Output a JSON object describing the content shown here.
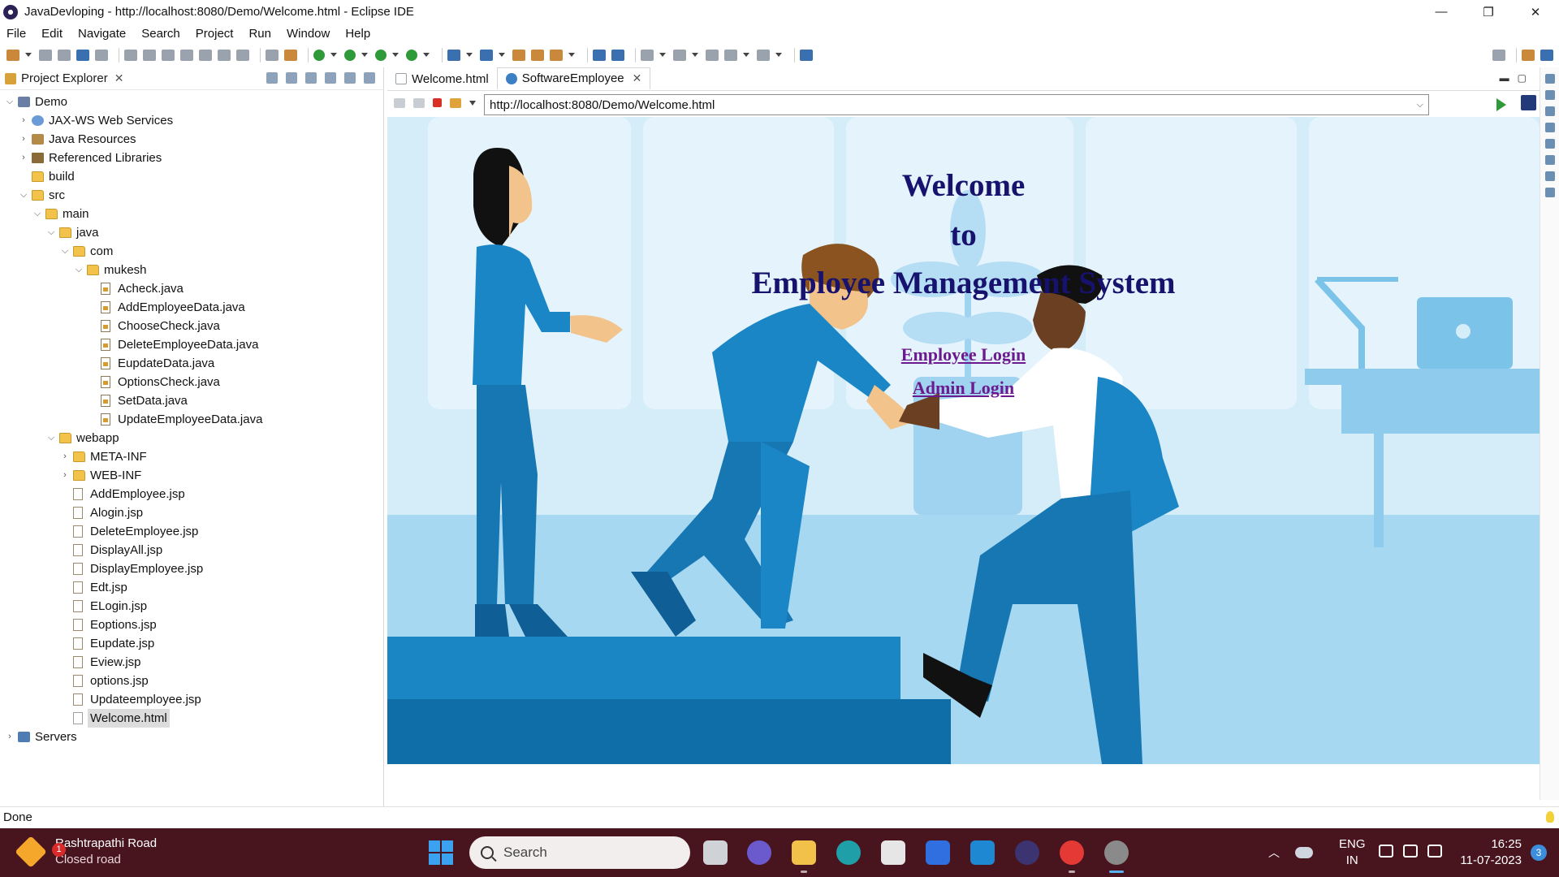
{
  "window": {
    "title": "JavaDevloping - http://localhost:8080/Demo/Welcome.html - Eclipse IDE",
    "controls": [
      "—",
      "❐",
      "✕"
    ]
  },
  "menu": [
    "File",
    "Edit",
    "Navigate",
    "Search",
    "Project",
    "Run",
    "Window",
    "Help"
  ],
  "explorer": {
    "title": "Project Explorer",
    "tree": [
      {
        "label": "Demo",
        "depth": 0,
        "twisty": "open",
        "icon": "project-icon"
      },
      {
        "label": "JAX-WS Web Services",
        "depth": 1,
        "twisty": "closed",
        "icon": "webservice-icon"
      },
      {
        "label": "Java Resources",
        "depth": 1,
        "twisty": "closed",
        "icon": "java-resources-icon"
      },
      {
        "label": "Referenced Libraries",
        "depth": 1,
        "twisty": "closed",
        "icon": "library-icon"
      },
      {
        "label": "build",
        "depth": 1,
        "twisty": "none",
        "icon": "folder-icon"
      },
      {
        "label": "src",
        "depth": 1,
        "twisty": "open",
        "icon": "folder-icon"
      },
      {
        "label": "main",
        "depth": 2,
        "twisty": "open",
        "icon": "folder-icon"
      },
      {
        "label": "java",
        "depth": 3,
        "twisty": "open",
        "icon": "folder-icon"
      },
      {
        "label": "com",
        "depth": 4,
        "twisty": "open",
        "icon": "folder-icon"
      },
      {
        "label": "mukesh",
        "depth": 5,
        "twisty": "open",
        "icon": "folder-icon"
      },
      {
        "label": "Acheck.java",
        "depth": 6,
        "twisty": "none",
        "icon": "java-file-icon"
      },
      {
        "label": "AddEmployeeData.java",
        "depth": 6,
        "twisty": "none",
        "icon": "java-file-icon"
      },
      {
        "label": "ChooseCheck.java",
        "depth": 6,
        "twisty": "none",
        "icon": "java-file-icon"
      },
      {
        "label": "DeleteEmployeeData.java",
        "depth": 6,
        "twisty": "none",
        "icon": "java-file-icon"
      },
      {
        "label": "EupdateData.java",
        "depth": 6,
        "twisty": "none",
        "icon": "java-file-icon"
      },
      {
        "label": "OptionsCheck.java",
        "depth": 6,
        "twisty": "none",
        "icon": "java-file-icon"
      },
      {
        "label": "SetData.java",
        "depth": 6,
        "twisty": "none",
        "icon": "java-file-icon"
      },
      {
        "label": "UpdateEmployeeData.java",
        "depth": 6,
        "twisty": "none",
        "icon": "java-file-icon"
      },
      {
        "label": "webapp",
        "depth": 3,
        "twisty": "open",
        "icon": "folder-icon"
      },
      {
        "label": "META-INF",
        "depth": 4,
        "twisty": "closed",
        "icon": "folder-icon"
      },
      {
        "label": "WEB-INF",
        "depth": 4,
        "twisty": "closed",
        "icon": "folder-icon"
      },
      {
        "label": "AddEmployee.jsp",
        "depth": 4,
        "twisty": "none",
        "icon": "jsp-file-icon"
      },
      {
        "label": "Alogin.jsp",
        "depth": 4,
        "twisty": "none",
        "icon": "jsp-file-icon"
      },
      {
        "label": "DeleteEmployee.jsp",
        "depth": 4,
        "twisty": "none",
        "icon": "jsp-file-icon"
      },
      {
        "label": "DisplayAll.jsp",
        "depth": 4,
        "twisty": "none",
        "icon": "jsp-file-icon"
      },
      {
        "label": "DisplayEmployee.jsp",
        "depth": 4,
        "twisty": "none",
        "icon": "jsp-file-icon"
      },
      {
        "label": "Edt.jsp",
        "depth": 4,
        "twisty": "none",
        "icon": "jsp-file-icon"
      },
      {
        "label": "ELogin.jsp",
        "depth": 4,
        "twisty": "none",
        "icon": "jsp-file-icon"
      },
      {
        "label": "Eoptions.jsp",
        "depth": 4,
        "twisty": "none",
        "icon": "jsp-file-icon"
      },
      {
        "label": "Eupdate.jsp",
        "depth": 4,
        "twisty": "none",
        "icon": "jsp-file-icon"
      },
      {
        "label": "Eview.jsp",
        "depth": 4,
        "twisty": "none",
        "icon": "jsp-file-icon"
      },
      {
        "label": "options.jsp",
        "depth": 4,
        "twisty": "none",
        "icon": "jsp-file-icon"
      },
      {
        "label": "Updateemployee.jsp",
        "depth": 4,
        "twisty": "none",
        "icon": "jsp-file-icon"
      },
      {
        "label": "Welcome.html",
        "depth": 4,
        "twisty": "none",
        "icon": "html-file-icon",
        "selected": true
      },
      {
        "label": "Servers",
        "depth": 0,
        "twisty": "closed",
        "icon": "servers-folder-icon"
      }
    ]
  },
  "editor": {
    "tabs": [
      {
        "label": "Welcome.html",
        "active": false
      },
      {
        "label": "SoftwareEmployee",
        "active": true
      }
    ],
    "url": "http://localhost:8080/Demo/Welcome.html"
  },
  "page": {
    "heading_line1": "Welcome",
    "heading_line2": "to",
    "heading_line3": "Employee Management System",
    "employee_link": "Employee Login",
    "admin_link": "Admin Login"
  },
  "status": {
    "text": "Done"
  },
  "taskbar": {
    "weather_title": "Rashtrapathi Road",
    "weather_sub": "Closed road",
    "weather_badge": "1",
    "search_placeholder": "Search",
    "lang_line1": "ENG",
    "lang_line2": "IN",
    "time": "16:25",
    "date": "11-07-2023",
    "notifications": "3"
  },
  "colors": {
    "heading": "#16126e",
    "link": "#6b1b8e",
    "scene_sky": "#cfeaf7",
    "scene_blue": "#1d86c4",
    "taskbar": "#48141e"
  }
}
